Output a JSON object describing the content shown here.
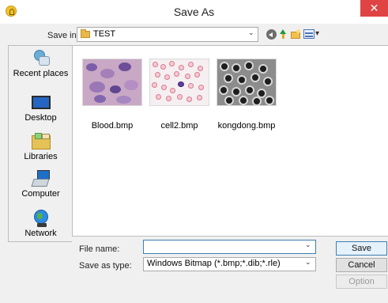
{
  "window": {
    "title": "Save As",
    "close_glyph": "✕"
  },
  "toolbar": {
    "save_in_label": "Save in:",
    "location": "TEST",
    "dropdown_glyph": "⌄",
    "views_caret": "▾"
  },
  "places": [
    {
      "label": "Recent places",
      "icon": "recent-places-icon"
    },
    {
      "label": "Desktop",
      "icon": "desktop-icon"
    },
    {
      "label": "Libraries",
      "icon": "libraries-icon"
    },
    {
      "label": "Computer",
      "icon": "computer-icon"
    },
    {
      "label": "Network",
      "icon": "network-icon"
    }
  ],
  "files": [
    {
      "name": "Blood.bmp"
    },
    {
      "name": "cell2.bmp"
    },
    {
      "name": "kongdong.bmp"
    }
  ],
  "form": {
    "file_name_label": "File name:",
    "file_name_value": "",
    "save_type_label": "Save as type:",
    "save_type_value": "Windows Bitmap (*.bmp;*.dib;*.rle)"
  },
  "buttons": {
    "save": "Save",
    "cancel": "Cancel",
    "option": "Option"
  },
  "colors": {
    "close": "#e04343",
    "accent": "#3c7fb1",
    "folder": "#e8b94a"
  }
}
